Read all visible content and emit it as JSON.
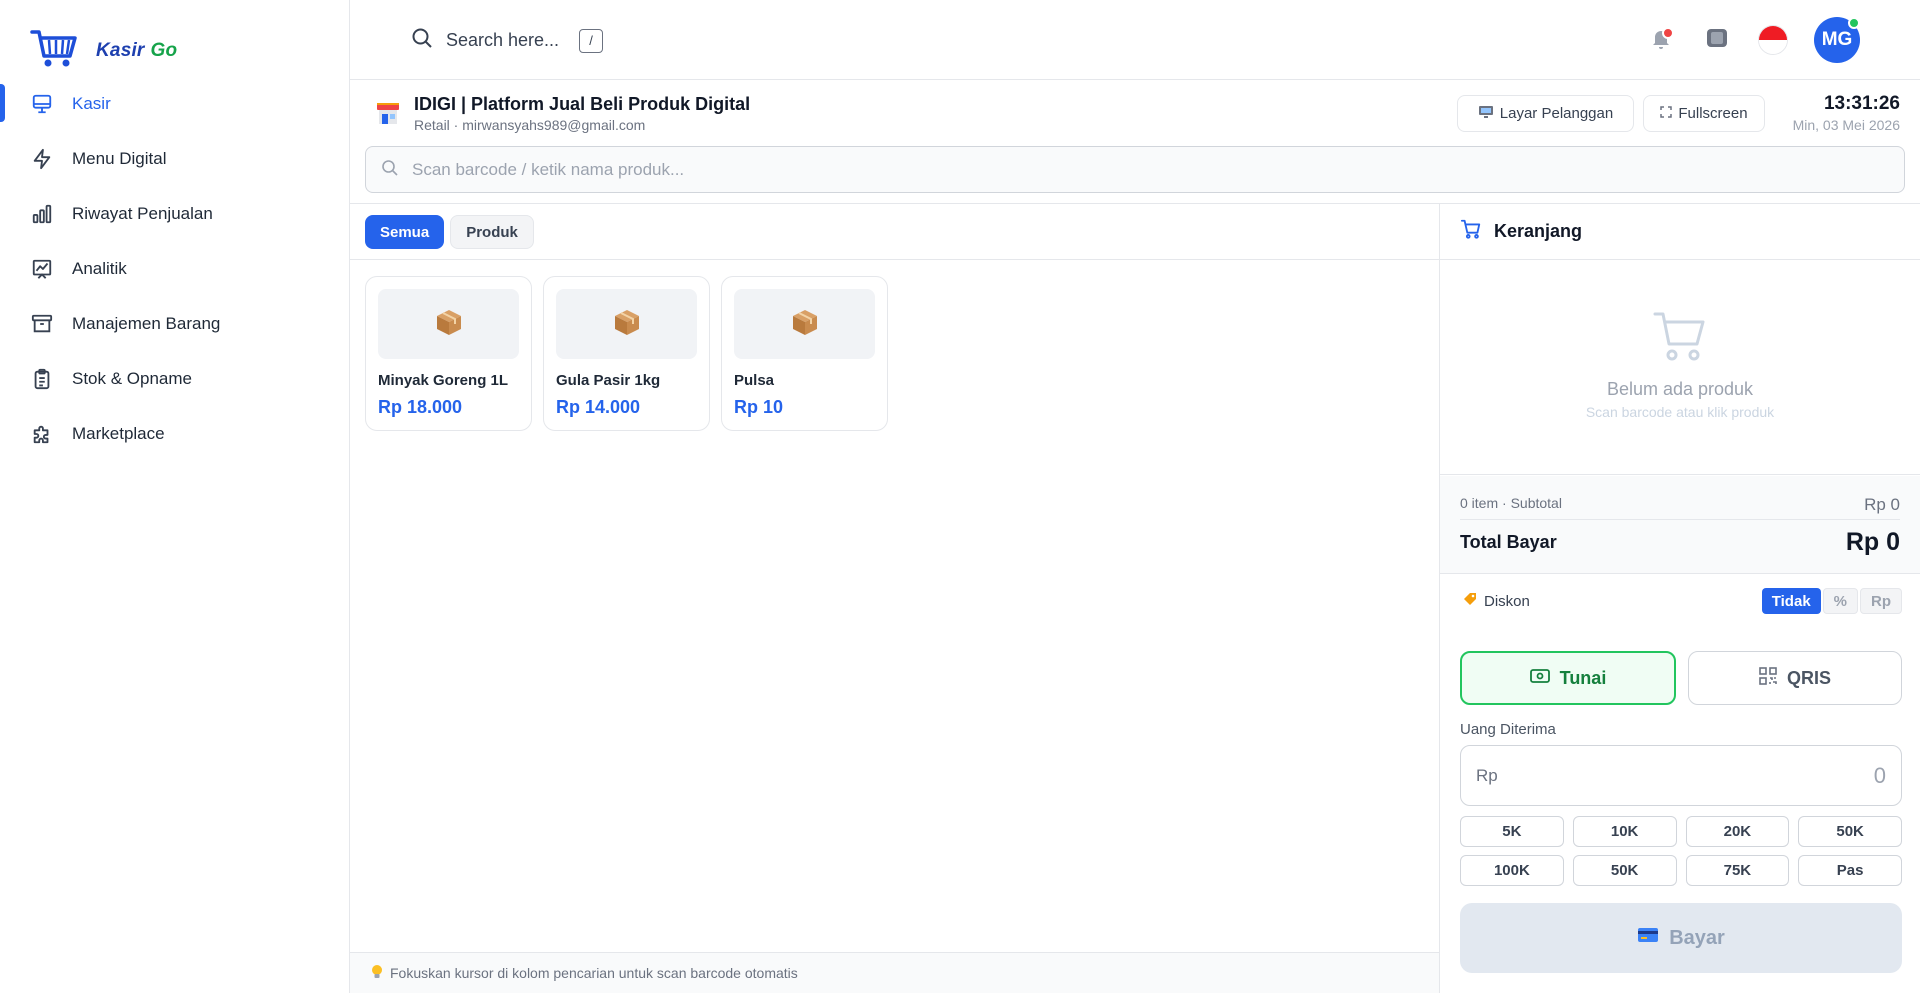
{
  "brand": {
    "name": "Kasir",
    "suffix": "Go"
  },
  "sidebar": {
    "items": [
      {
        "label": "Kasir",
        "icon": "monitor-icon",
        "active": true
      },
      {
        "label": "Menu Digital",
        "icon": "lightning-icon"
      },
      {
        "label": "Riwayat Penjualan",
        "icon": "bar-chart-icon"
      },
      {
        "label": "Analitik",
        "icon": "trend-chart-icon"
      },
      {
        "label": "Manajemen Barang",
        "icon": "archive-box-icon"
      },
      {
        "label": "Stok & Opname",
        "icon": "clipboard-icon"
      },
      {
        "label": "Marketplace",
        "icon": "puzzle-icon"
      }
    ]
  },
  "topbar": {
    "search_text": "Search here...",
    "search_shortcut": "/",
    "avatar_initials": "MG"
  },
  "store": {
    "name": "IDIGI | Platform Jual Beli Produk Digital",
    "subtitle": "Retail · mirwansyahs989@gmail.com",
    "customer_screen_label": "Layar Pelanggan",
    "fullscreen_label": "Fullscreen",
    "time": "13:31:26",
    "date": "Min, 03 Mei 2026"
  },
  "scan": {
    "placeholder": "Scan barcode / ketik nama produk..."
  },
  "filters": [
    "Semua",
    "Produk"
  ],
  "products": [
    {
      "name": "Minyak Goreng 1L",
      "price": "Rp 18.000"
    },
    {
      "name": "Gula Pasir 1kg",
      "price": "Rp 14.000"
    },
    {
      "name": "Pulsa",
      "price": "Rp 10"
    }
  ],
  "footer_hint": "Fokuskan kursor di kolom pencarian untuk scan barcode otomatis",
  "cart": {
    "title": "Keranjang",
    "empty_title": "Belum ada produk",
    "empty_subtitle": "Scan barcode atau klik produk",
    "subtotal_label": "0 item · Subtotal",
    "subtotal_value": "Rp 0",
    "total_label": "Total Bayar",
    "total_value": "Rp 0",
    "discount_label": "Diskon",
    "discount_options": [
      "Tidak",
      "%",
      "Rp"
    ],
    "pay_methods": [
      "Tunai",
      "QRIS"
    ],
    "received_label": "Uang Diterima",
    "received_currency": "Rp",
    "received_value": "0",
    "quick_amounts": [
      "5K",
      "10K",
      "20K",
      "50K",
      "100K",
      "50K",
      "75K",
      "Pas"
    ],
    "pay_button": "Bayar"
  },
  "colors": {
    "primary": "#2563eb",
    "success": "#22c55e",
    "brand_green": "#16a34a"
  }
}
